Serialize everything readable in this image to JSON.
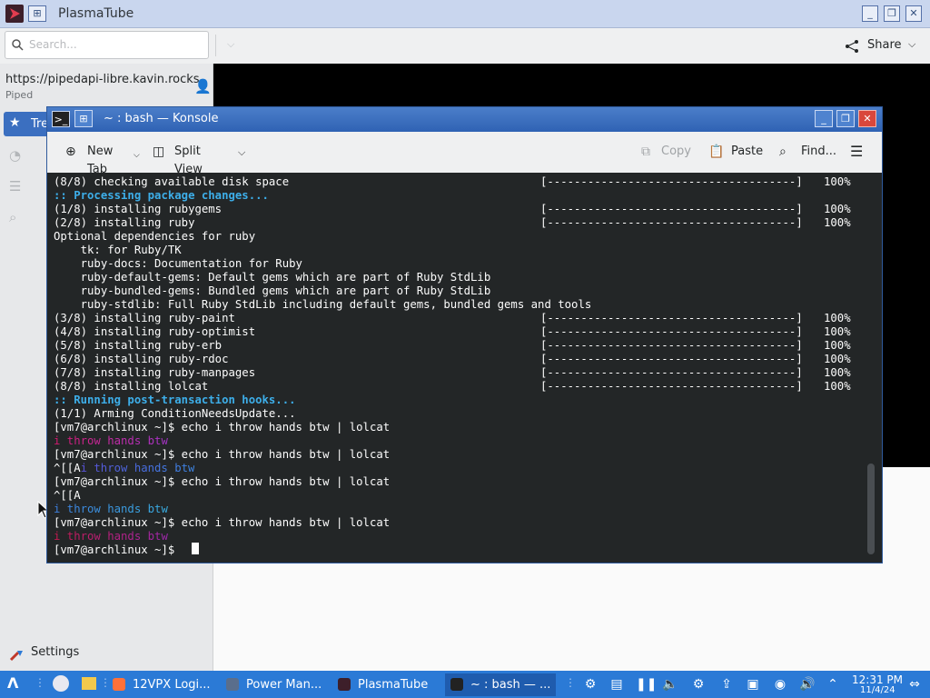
{
  "plasmatube": {
    "title": "PlasmaTube",
    "search_placeholder": "Search...",
    "share_label": "Share",
    "instance_url": "https://pipedapi-libre.kavin.rocks",
    "instance_name": "Piped",
    "nav_trending": "Tre",
    "settings_label": "Settings"
  },
  "konsole": {
    "title": "~ : bash — Konsole",
    "toolbar": {
      "new_tab": "New Tab",
      "split_view": "Split View",
      "copy": "Copy",
      "paste": "Paste",
      "find": "Find..."
    },
    "progress_bar": "[-------------------------------------]",
    "percent": "100%",
    "lines": [
      {
        "text": "(8/8) checking available disk space",
        "progress": true
      },
      {
        "text": ":: Processing package changes...",
        "style": "blue"
      },
      {
        "text": "(1/8) installing rubygems",
        "progress": true
      },
      {
        "text": "(2/8) installing ruby",
        "progress": true
      },
      {
        "text": "Optional dependencies for ruby"
      },
      {
        "text": "    tk: for Ruby/TK"
      },
      {
        "text": "    ruby-docs: Documentation for Ruby"
      },
      {
        "text": "    ruby-default-gems: Default gems which are part of Ruby StdLib"
      },
      {
        "text": "    ruby-bundled-gems: Bundled gems which are part of Ruby StdLib"
      },
      {
        "text": "    ruby-stdlib: Full Ruby StdLib including default gems, bundled gems and tools"
      },
      {
        "text": "(3/8) installing ruby-paint",
        "progress": true
      },
      {
        "text": "(4/8) installing ruby-optimist",
        "progress": true
      },
      {
        "text": "(5/8) installing ruby-erb",
        "progress": true
      },
      {
        "text": "(6/8) installing ruby-rdoc",
        "progress": true
      },
      {
        "text": "(7/8) installing ruby-manpages",
        "progress": true
      },
      {
        "text": "(8/8) installing lolcat",
        "progress": true
      },
      {
        "text": ":: Running post-transaction hooks...",
        "style": "blue"
      },
      {
        "text": "(1/1) Arming ConditionNeedsUpdate..."
      },
      {
        "text": "[vm7@archlinux ~]$ echo i throw hands btw | lolcat"
      },
      {
        "text": "i throw hands btw",
        "gradient": [
          "#d3186d",
          "#c52ba5",
          "#a533c9"
        ]
      },
      {
        "text": "[vm7@archlinux ~]$ echo i throw hands btw | lolcat"
      },
      {
        "text": "^[[A",
        "suffix": "i throw hands btw",
        "gradient": [
          "#5a52d8",
          "#4a6be0",
          "#3d86e4"
        ]
      },
      {
        "text": "[vm7@archlinux ~]$ echo i throw hands btw | lolcat"
      },
      {
        "text": "^[[A"
      },
      {
        "text": "i throw hands btw",
        "gradient": [
          "#3d7fe0",
          "#3b97e2",
          "#39aee2"
        ]
      },
      {
        "text": "[vm7@archlinux ~]$ echo i throw hands btw | lolcat"
      },
      {
        "text": "i throw hands btw",
        "gradient": [
          "#c41a4e",
          "#b8207f",
          "#9e29ad"
        ]
      },
      {
        "text": "[vm7@archlinux ~]$ "
      }
    ]
  },
  "taskbar": {
    "tasks": [
      {
        "label": "12VPX Logi...",
        "icon": "firefox-icon"
      },
      {
        "label": "Power Man...",
        "icon": "power-manager-icon"
      },
      {
        "label": "PlasmaTube",
        "icon": "plasmatube-icon"
      },
      {
        "label": "~ : bash — ...",
        "icon": "terminal-icon"
      }
    ],
    "clock_time": "12:31 PM",
    "clock_date": "11/4/24"
  }
}
